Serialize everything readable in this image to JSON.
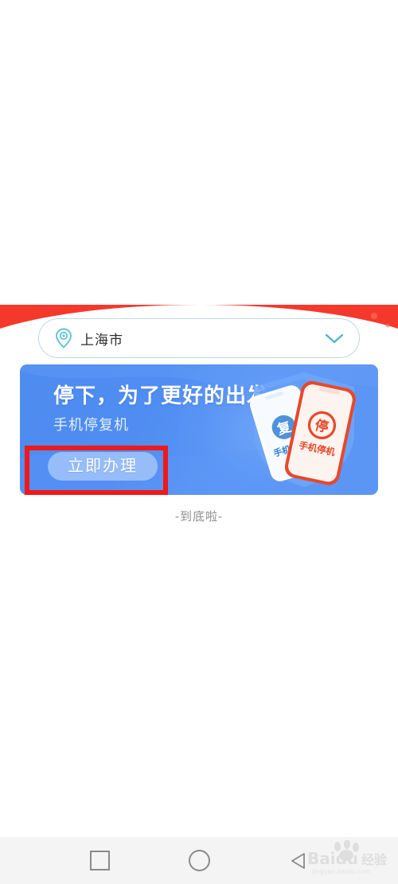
{
  "app": {
    "title": "手机停复机",
    "accent_red": "#f4392c",
    "accent_blue": "#4e8cf0",
    "annotation_red": "#f01818",
    "teal": "#5cc4d6"
  },
  "city_selector": {
    "pin_icon": "location-pin-icon",
    "city": "上海市",
    "chevron_icon": "chevron-down-icon"
  },
  "banner": {
    "title": "停下，为了更好的出发",
    "subtitle": "手机停复机",
    "cta_label": "立即办理",
    "illustration": {
      "shield_icon": "shield-icon",
      "front_phone_badge": "停",
      "front_phone_label": "手机停机",
      "back_phone_badge": "复",
      "back_phone_label": "手机复机"
    }
  },
  "list": {
    "end_marker": "-到底啦-"
  },
  "navbar": {
    "recent_icon": "square-recents-icon",
    "home_icon": "circle-home-icon",
    "back_icon": "triangle-back-icon"
  },
  "watermark": {
    "brand": "Baidu",
    "suffix": "经验",
    "url": "jingyan.baidu.com"
  }
}
